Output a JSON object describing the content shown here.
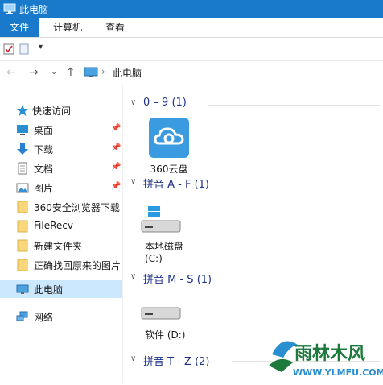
{
  "window": {
    "title": "此电脑"
  },
  "ribbon": {
    "tabs": [
      "文件",
      "计算机",
      "查看"
    ]
  },
  "address": {
    "path": "此电脑"
  },
  "sidebar": {
    "quick_access": "快速访问",
    "items": [
      {
        "label": "桌面",
        "icon": "desktop-icon",
        "pinned": true
      },
      {
        "label": "下载",
        "icon": "download-arrow-icon",
        "pinned": true
      },
      {
        "label": "文档",
        "icon": "document-icon",
        "pinned": true
      },
      {
        "label": "图片",
        "icon": "picture-icon",
        "pinned": true
      },
      {
        "label": "360安全浏览器下载",
        "icon": "folder-icon",
        "pinned": false
      },
      {
        "label": "FileRecv",
        "icon": "folder-icon",
        "pinned": false
      },
      {
        "label": "新建文件夹",
        "icon": "folder-icon",
        "pinned": false
      },
      {
        "label": "正确找回原来的图片",
        "icon": "folder-icon",
        "pinned": false
      }
    ],
    "this_pc": "此电脑",
    "network": "网络"
  },
  "groups": [
    {
      "title": "0 – 9 (1)",
      "items": [
        {
          "label": "360云盘",
          "icon": "cloud-drive-icon"
        }
      ]
    },
    {
      "title": "拼音 A - F (1)",
      "items": [
        {
          "label": "本地磁盘",
          "sub": "(C:)",
          "icon": "windows-drive-icon"
        }
      ]
    },
    {
      "title": "拼音 M - S (1)",
      "items": [
        {
          "label": "软件 (D:)",
          "icon": "drive-icon"
        }
      ]
    },
    {
      "title": "拼音 T - Z (2)",
      "items": []
    }
  ],
  "watermark": {
    "brand": "雨林木风",
    "url": "WWW.YLMFU.COM",
    "colors": {
      "primary": "#1e7a3c",
      "accent": "#2a8fd0"
    }
  },
  "colors": {
    "titlebar": "#1979ca",
    "selected": "#cce8ff",
    "group_title": "#1e3287"
  }
}
